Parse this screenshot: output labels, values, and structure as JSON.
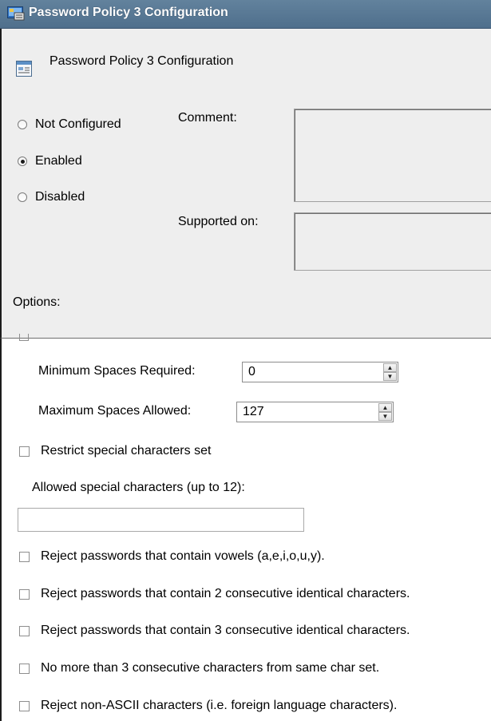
{
  "window": {
    "title": "Password Policy 3 Configuration",
    "icon": "policy-window-icon"
  },
  "header": {
    "title": "Password Policy 3 Configuration",
    "icon": "policy-document-icon"
  },
  "state": {
    "options": [
      {
        "label": "Not Configured",
        "checked": false
      },
      {
        "label": "Enabled",
        "checked": true
      },
      {
        "label": "Disabled",
        "checked": false
      }
    ]
  },
  "comment": {
    "label": "Comment:",
    "value": ""
  },
  "supported_on": {
    "label": "Supported on:",
    "value": ""
  },
  "options_label": "Options:",
  "options": {
    "minimum_spaces": {
      "label": "Minimum Spaces Required:",
      "value": "0"
    },
    "maximum_spaces": {
      "label": "Maximum Spaces Allowed:",
      "value": "127"
    },
    "restrict_special": {
      "label": "Restrict special characters set",
      "checked": false
    },
    "allowed_special": {
      "label": "Allowed special characters (up to 12):",
      "value": ""
    },
    "checkboxes": [
      {
        "label": "Reject passwords that contain vowels (a,e,i,o,u,y).",
        "checked": false
      },
      {
        "label": "Reject passwords that contain 2 consecutive identical characters.",
        "checked": false
      },
      {
        "label": "Reject passwords that contain 3 consecutive identical characters.",
        "checked": false
      },
      {
        "label": "No more than 3 consecutive characters from same char set.",
        "checked": false
      },
      {
        "label": "Reject non-ASCII characters (i.e. foreign language characters).",
        "checked": false
      }
    ]
  },
  "colors": {
    "titlebar": "#5a7a96",
    "panel": "#eeeeee",
    "options_bg": "#ffffff"
  }
}
